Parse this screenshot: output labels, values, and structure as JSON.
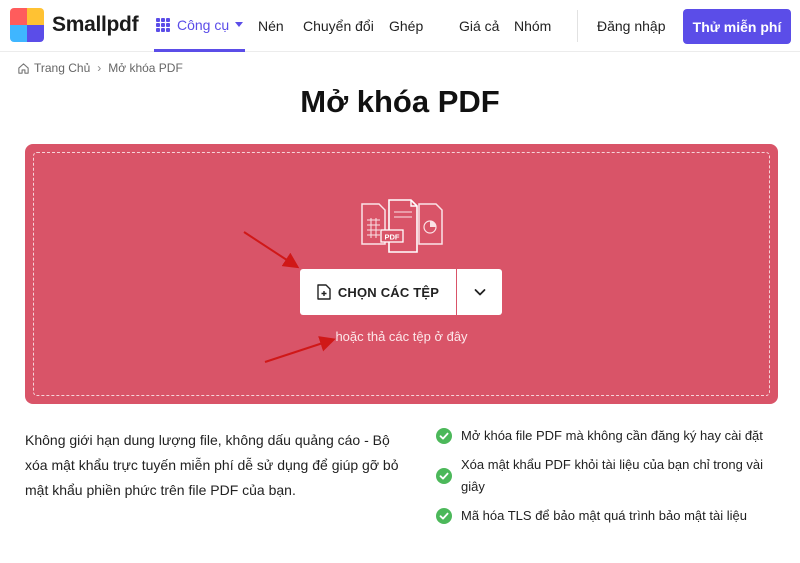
{
  "nav": {
    "brand": "Smallpdf",
    "tools_label": "Công cụ",
    "links": [
      "Nén",
      "Chuyển đổi",
      "Ghép",
      "Giá cả",
      "Nhóm"
    ],
    "login": "Đăng nhập",
    "cta": "Thử miễn phí",
    "accent_color": "#5b4de8"
  },
  "breadcrumb": {
    "home": "Trang Chủ",
    "separator": "›",
    "current": "Mở khóa PDF"
  },
  "page_title": "Mở khóa PDF",
  "dropzone": {
    "background_color": "#d95468",
    "choose_label": "CHỌN CÁC TỆP",
    "hint": "hoặc thả các tệp ở đây",
    "file_badge": "PDF"
  },
  "description": "Không giới hạn dung lượng file, không dấu quảng cáo - Bộ xóa mật khẩu trực tuyến miễn phí dễ sử dụng để giúp gỡ bỏ mật khẩu phiền phức trên file PDF của bạn.",
  "features": [
    "Mở khóa file PDF mà không cần đăng ký hay cài đặt",
    "Xóa mật khẩu PDF khỏi tài liệu của bạn chỉ trong vài giây",
    "Mã hóa TLS để bảo mật quá trình bảo mật tài liệu"
  ],
  "check_color": "#4cb85a"
}
